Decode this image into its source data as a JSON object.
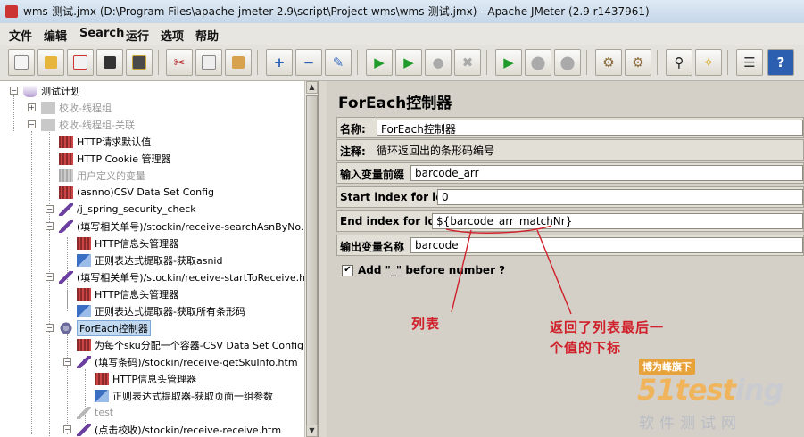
{
  "window": {
    "title": "wms-测试.jmx (D:\\Program Files\\apache-jmeter-2.9\\script\\Project-wms\\wms-测试.jmx) - Apache JMeter (2.9 r1437961)"
  },
  "menu": [
    "文件",
    "编辑",
    "Search",
    "运行",
    "选项",
    "帮助"
  ],
  "toolbar": [
    {
      "name": "new-icon"
    },
    {
      "name": "open-icon"
    },
    {
      "name": "close-file-icon"
    },
    {
      "name": "save-icon"
    },
    {
      "name": "save-screenshot-icon"
    },
    {
      "name": "cut-icon"
    },
    {
      "name": "copy-icon"
    },
    {
      "name": "paste-icon"
    },
    {
      "name": "expand-icon",
      "glyph": "+"
    },
    {
      "name": "collapse-icon",
      "glyph": "−"
    },
    {
      "name": "toggle-icon"
    },
    {
      "name": "start-icon"
    },
    {
      "name": "start-no-pause-icon"
    },
    {
      "name": "stop-icon"
    },
    {
      "name": "shutdown-icon"
    },
    {
      "name": "remote-start-icon"
    },
    {
      "name": "remote-stop-icon"
    },
    {
      "name": "remote-shutdown-icon"
    },
    {
      "name": "clear-icon"
    },
    {
      "name": "clear-all-icon"
    },
    {
      "name": "search-icon"
    },
    {
      "name": "reset-search-icon"
    },
    {
      "name": "function-helper-icon"
    },
    {
      "name": "help-icon",
      "glyph": "?"
    }
  ],
  "tree": [
    {
      "label": "测试计划",
      "icon": "flask-icon"
    },
    {
      "label": "校收-线程组",
      "icon": "thread-group-icon",
      "dim": true
    },
    {
      "label": "校收-线程组-关联",
      "icon": "thread-group-icon",
      "dim": true
    },
    {
      "label": "HTTP请求默认值",
      "icon": "config-icon"
    },
    {
      "label": "HTTP Cookie 管理器",
      "icon": "config-icon"
    },
    {
      "label": "用户定义的变量",
      "icon": "config-icon",
      "dim": true
    },
    {
      "label": "(asnno)CSV Data Set Config",
      "icon": "config-icon"
    },
    {
      "label": "/j_spring_security_check",
      "icon": "sampler-icon"
    },
    {
      "label": "(填写相关单号)/stockin/receive-searchAsnByNo.htm",
      "icon": "sampler-icon"
    },
    {
      "label": "HTTP信息头管理器",
      "icon": "config-icon"
    },
    {
      "label": "正则表达式提取器-获取asnid",
      "icon": "post-processor-icon"
    },
    {
      "label": "(填写相关单号)/stockin/receive-startToReceive.htm",
      "icon": "sampler-icon"
    },
    {
      "label": "HTTP信息头管理器",
      "icon": "config-icon"
    },
    {
      "label": "正则表达式提取器-获取所有条形码",
      "icon": "post-processor-icon"
    },
    {
      "label": "ForEach控制器",
      "icon": "controller-icon",
      "selected": true
    },
    {
      "label": "为每个sku分配一个容器-CSV Data Set Config",
      "icon": "config-icon"
    },
    {
      "label": "(填写条码)/stockin/receive-getSkuInfo.htm",
      "icon": "sampler-icon"
    },
    {
      "label": "HTTP信息头管理器",
      "icon": "config-icon"
    },
    {
      "label": "正则表达式提取器-获取页面一组参数",
      "icon": "post-processor-icon"
    },
    {
      "label": "test",
      "icon": "sampler-icon",
      "dim": true
    },
    {
      "label": "(点击校收)/stockin/receive-receive.htm",
      "icon": "sampler-icon"
    }
  ],
  "panel": {
    "title": "ForEach控制器",
    "name_label": "名称:",
    "name_value": "ForEach控制器",
    "comment_label": "注释:",
    "comment_value": "循环返回出的条形码编号",
    "input_prefix_label": "输入变量前缀",
    "input_prefix_value": "barcode_arr",
    "start_index_label": "Start index for loop",
    "start_index_value": "0",
    "end_index_label": "End index for loop",
    "end_index_value": "${barcode_arr_matchNr}",
    "output_var_label": "输出变量名称",
    "output_var_value": "barcode",
    "add_underscore_label": "Add \"_\" before number ?",
    "add_underscore_checked": true
  },
  "annotations": {
    "left": "列表",
    "right_line1": "返回了列表最后一",
    "right_line2": "个值的下标"
  },
  "watermark": {
    "tag": "博为峰旗下",
    "logo_a": "51test",
    "logo_b": "ing",
    "sub": "软件测试网"
  },
  "colors": {
    "annotation": "#d0202a",
    "selection": "#c2d9f2"
  }
}
